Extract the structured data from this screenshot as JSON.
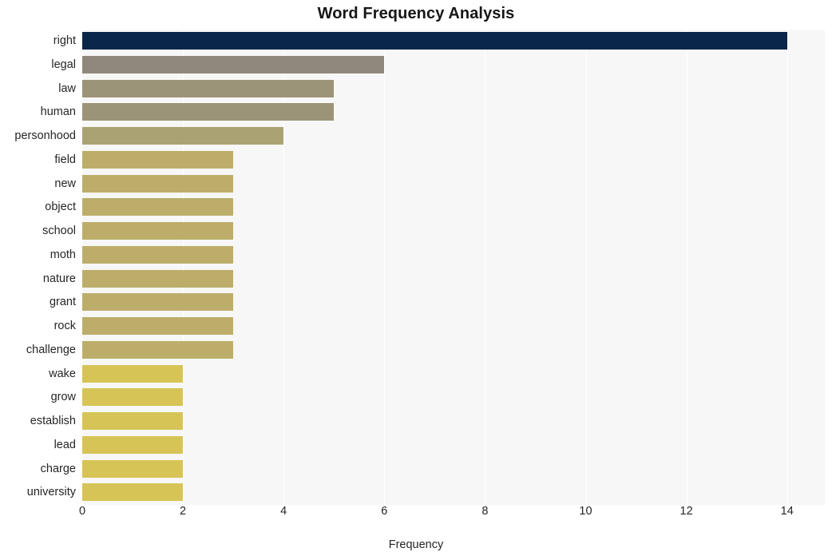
{
  "chart_data": {
    "type": "bar",
    "orientation": "horizontal",
    "title": "Word Frequency Analysis",
    "xlabel": "Frequency",
    "ylabel": "",
    "categories": [
      "right",
      "legal",
      "law",
      "human",
      "personhood",
      "field",
      "new",
      "object",
      "school",
      "moth",
      "nature",
      "grant",
      "rock",
      "challenge",
      "wake",
      "grow",
      "establish",
      "lead",
      "charge",
      "university"
    ],
    "values": [
      14,
      6,
      5,
      5,
      4,
      3,
      3,
      3,
      3,
      3,
      3,
      3,
      3,
      3,
      2,
      2,
      2,
      2,
      2,
      2
    ],
    "bar_colors": [
      "#0a2649",
      "#8e897c",
      "#9c9478",
      "#9c9478",
      "#aaa273",
      "#bcae6a",
      "#bcae6a",
      "#bcae6a",
      "#bcae6a",
      "#bcae6a",
      "#bcae6a",
      "#bcae6a",
      "#bcae6a",
      "#bcae6a",
      "#d6c456",
      "#d6c456",
      "#d6c456",
      "#d6c456",
      "#d6c456",
      "#d6c456"
    ],
    "xlim": [
      0,
      14.75
    ],
    "xticks": [
      0,
      2,
      4,
      6,
      8,
      10,
      12,
      14
    ],
    "xtick_labels": [
      "0",
      "2",
      "4",
      "6",
      "8",
      "10",
      "12",
      "14"
    ],
    "grid": true,
    "grid_color": "#ffffff",
    "plot_background": "#f7f7f7",
    "figure_background": "#ffffff",
    "legend": null,
    "legend_position": "none"
  }
}
